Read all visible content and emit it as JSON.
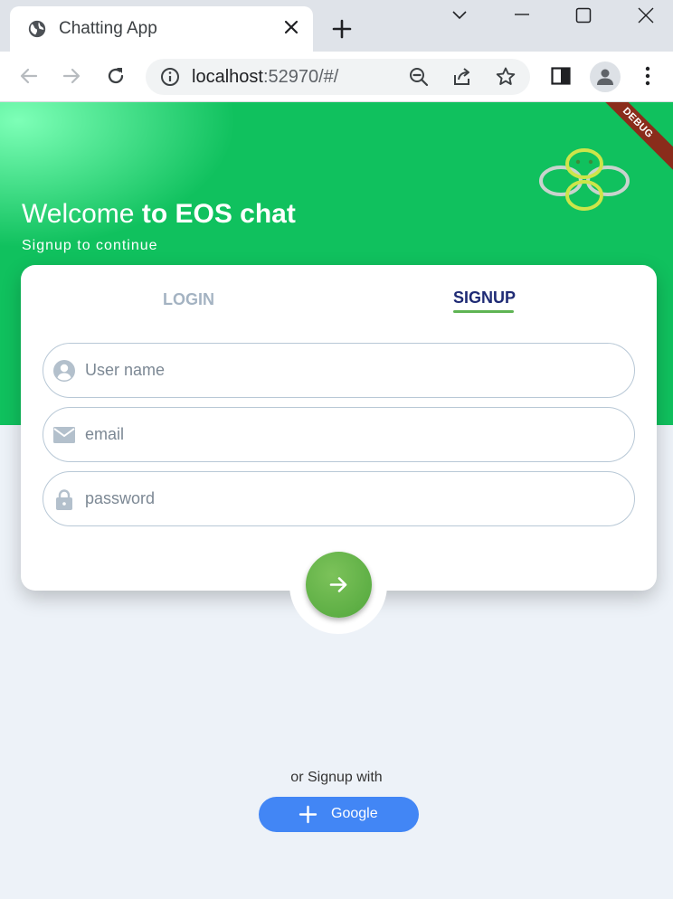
{
  "browser": {
    "tab_title": "Chatting App",
    "url_host": "localhost",
    "url_path": ":52970/#/"
  },
  "debug_banner": "DEBUG",
  "hero": {
    "welcome_prefix": "Welcome ",
    "welcome_bold": "to EOS chat",
    "subtitle": "Signup to continue"
  },
  "tabs": {
    "login": "LOGIN",
    "signup": "SIGNUP",
    "active": "signup"
  },
  "form": {
    "username_placeholder": "User name",
    "email_placeholder": "email",
    "password_placeholder": "password",
    "username_icon": "person-icon",
    "email_icon": "mail-icon",
    "password_icon": "lock-icon"
  },
  "social": {
    "or_text": "or Signup with",
    "google_label": "Google"
  },
  "colors": {
    "hero_green": "#10c15e",
    "active_tab": "#1f2b75",
    "inactive_tab": "#a4b3c2",
    "tab_underline": "#5fb454",
    "google_blue": "#4286f5"
  }
}
